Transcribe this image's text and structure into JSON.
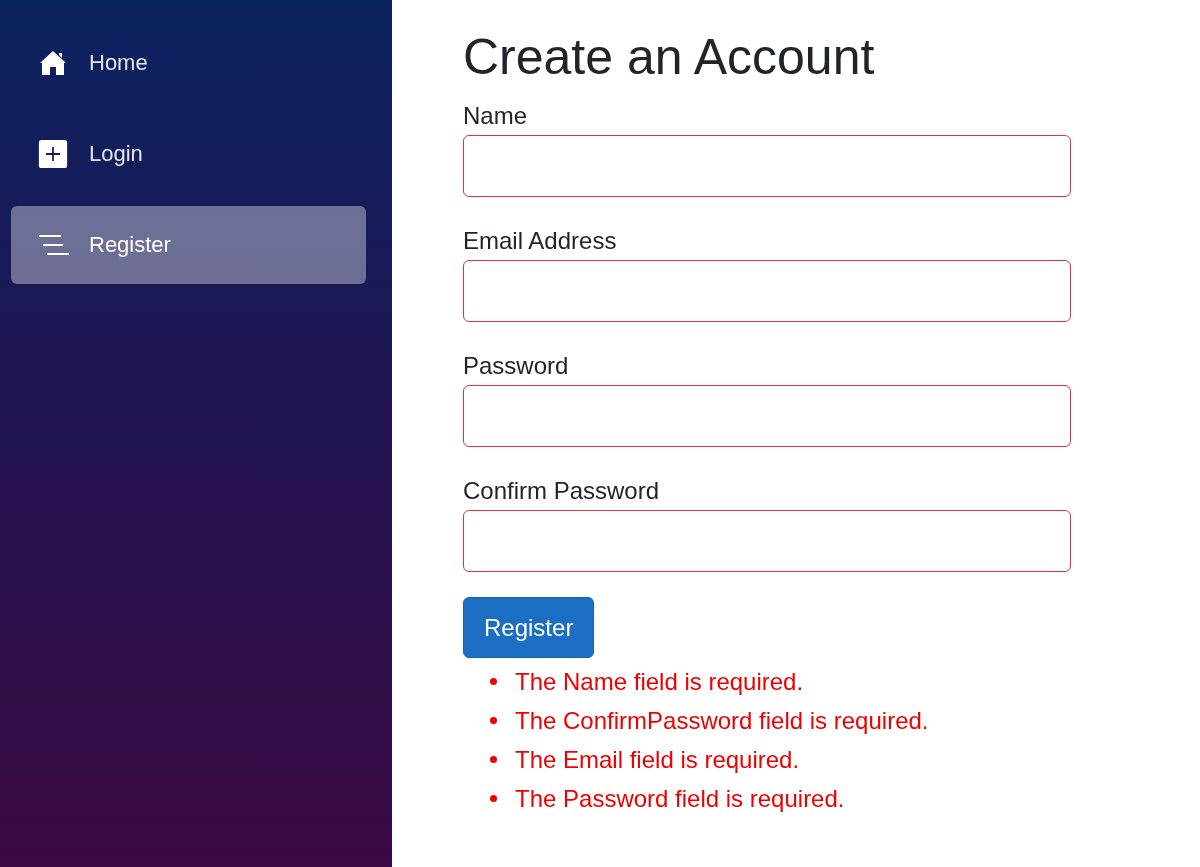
{
  "sidebar": {
    "items": [
      {
        "label": "Home",
        "kind": "home",
        "selected": false
      },
      {
        "label": "Login",
        "kind": "plus",
        "selected": false
      },
      {
        "label": "Register",
        "kind": "lines",
        "selected": true
      }
    ]
  },
  "form": {
    "title": "Create an Account",
    "fields": [
      {
        "label": "Name",
        "invalid": true
      },
      {
        "label": "Email Address",
        "invalid": true
      },
      {
        "label": "Password",
        "invalid": true
      },
      {
        "label": "Confirm Password",
        "invalid": true
      }
    ],
    "submit": "Register",
    "errors": [
      "The Name field is required.",
      "The ConfirmPassword field is required.",
      "The Email field is required.",
      "The Password field is required."
    ]
  }
}
